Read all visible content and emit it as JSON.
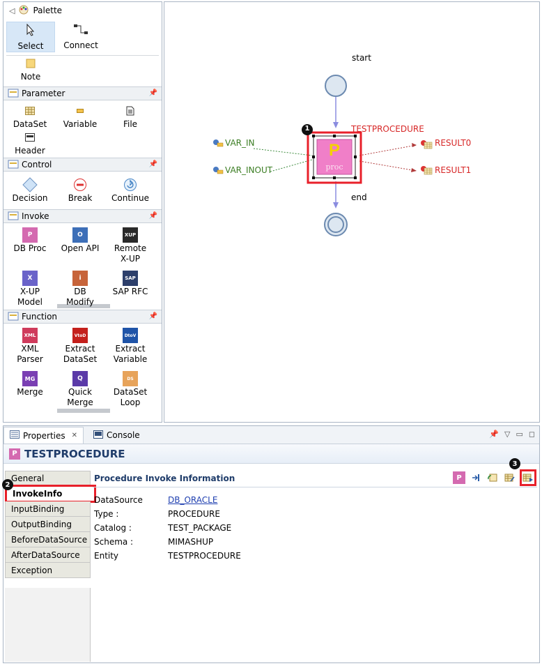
{
  "palette": {
    "title": "Palette",
    "tools": [
      {
        "label": "Select"
      },
      {
        "label": "Connect"
      }
    ],
    "note": "Note",
    "drawers": {
      "parameter": {
        "title": "Parameter",
        "items": [
          "DataSet",
          "Variable",
          "File",
          "Header"
        ]
      },
      "control": {
        "title": "Control",
        "items": [
          "Decision",
          "Break",
          "Continue"
        ]
      },
      "invoke": {
        "title": "Invoke",
        "items": [
          "DB Proc",
          "Open API",
          "Remote X-UP",
          "X-UP Model",
          "DB Modify",
          "SAP RFC"
        ]
      },
      "function": {
        "title": "Function",
        "items": [
          "XML Parser",
          "Extract DataSet",
          "Extract Variable",
          "Merge",
          "Quick Merge",
          "DataSet Loop"
        ]
      }
    }
  },
  "canvas": {
    "start_label": "start",
    "end_label": "end",
    "node_title": "TESTPROCEDURE",
    "node_icon_letter": "P",
    "node_icon_sub": "proc",
    "inputs": [
      "VAR_IN",
      "VAR_INOUT"
    ],
    "outputs": [
      "RESULT0",
      "RESULT1"
    ]
  },
  "properties": {
    "tabs": [
      "Properties",
      "Console"
    ],
    "title": "TESTPROCEDURE",
    "side_tabs": [
      "General",
      "InvokeInfo",
      "InputBinding",
      "OutputBinding",
      "BeforeDataSource",
      "AfterDataSource",
      "Exception"
    ],
    "section_title": "Procedure Invoke Information",
    "fields": [
      {
        "key": "DataSource",
        "value": "DB_ORACLE"
      },
      {
        "key": "Type :",
        "value": "PROCEDURE"
      },
      {
        "key": "Catalog :",
        "value": "TEST_PACKAGE"
      },
      {
        "key": "Schema :",
        "value": "MIMASHUP"
      },
      {
        "key": "Entity",
        "value": "TESTPROCEDURE"
      }
    ]
  },
  "callouts": [
    "1",
    "2",
    "3"
  ],
  "colors": {
    "highlight": "#e8202a",
    "node_fill": "#f07fc8",
    "proc_text": "#d72626",
    "var_text": "#3b7d23"
  }
}
